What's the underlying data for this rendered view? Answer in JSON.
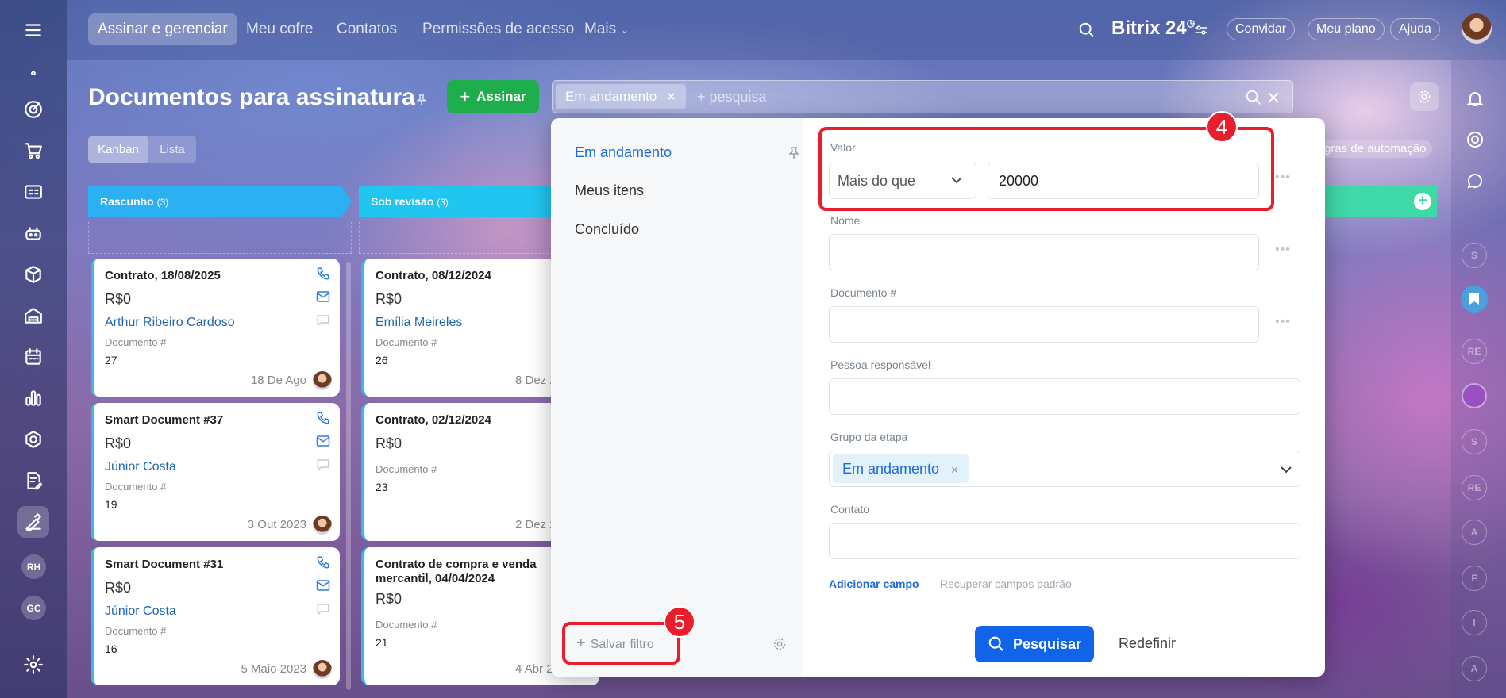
{
  "topnav": {
    "tabs": [
      "Assinar e gerenciar",
      "Meu cofre",
      "Contatos",
      "Permissões de acesso",
      "Mais"
    ],
    "brand": "Bitrix",
    "brand_num": "24",
    "invite": "Convidar",
    "plan": "Meu plano",
    "help": "Ajuda"
  },
  "header": {
    "title": "Documentos para assinatura",
    "sign_button": "Assinar",
    "filter_chip": "Em andamento",
    "search_placeholder": "+ pesquisa"
  },
  "view_toggle": {
    "kanban": "Kanban",
    "list": "Lista"
  },
  "automation_label": "gras de automação",
  "left_avatars": [
    "RH",
    "GC"
  ],
  "right_avatars": [
    "S",
    "RE",
    "S",
    "RE",
    "A",
    "F",
    "I",
    "A"
  ],
  "columns": [
    {
      "title": "Rascunho",
      "count": "(3)",
      "color": "#2bb0f2"
    },
    {
      "title": "Sob revisão",
      "count": "(3)",
      "color": "#20c5f0"
    }
  ],
  "cards_col1": [
    {
      "title": "Contrato, 18/08/2025",
      "price": "R$0",
      "contact": "Arthur Ribeiro Cardoso",
      "doc_label": "Documento #",
      "doc_num": "27",
      "date": "18 De Ago"
    },
    {
      "title": "Smart Document #37",
      "price": "R$0",
      "contact": "Júnior Costa",
      "doc_label": "Documento #",
      "doc_num": "19",
      "date": "3 Out 2023"
    },
    {
      "title": "Smart Document #31",
      "price": "R$0",
      "contact": "Júnior Costa",
      "doc_label": "Documento #",
      "doc_num": "16",
      "date": "5 Maio 2023"
    }
  ],
  "cards_col2": [
    {
      "title": "Contrato, 08/12/2024",
      "price": "R$0",
      "contact": "Emília Meireles",
      "doc_label": "Documento #",
      "doc_num": "26",
      "date": "8 Dez 2"
    },
    {
      "title": "Contrato, 02/12/2024",
      "price": "R$0",
      "contact": "",
      "doc_label": "Documento #",
      "doc_num": "23",
      "date": "2 Dez 2"
    },
    {
      "title": "Contrato de compra e venda mercantil, 04/04/2024",
      "price": "R$0",
      "contact": "",
      "doc_label": "Documento #",
      "doc_num": "21",
      "date": "4 Abr 2"
    }
  ],
  "filter": {
    "presets": [
      "Em andamento",
      "Meus itens",
      "Concluído"
    ],
    "save_filter": "Salvar filtro",
    "valor_label": "Valor",
    "valor_operator": "Mais do que",
    "valor_value": "20000",
    "nome_label": "Nome",
    "documento_label": "Documento #",
    "pessoa_label": "Pessoa responsável",
    "grupo_label": "Grupo da etapa",
    "grupo_chip": "Em andamento",
    "contato_label": "Contato",
    "add_field": "Adicionar campo",
    "restore_fields": "Recuperar campos padrão",
    "search_button": "Pesquisar",
    "reset_button": "Redefinir"
  },
  "callouts": [
    "4",
    "5"
  ],
  "colors": {
    "accent": "#1064ea",
    "callout": "#ea1d2c",
    "green": "#1fae4e"
  }
}
